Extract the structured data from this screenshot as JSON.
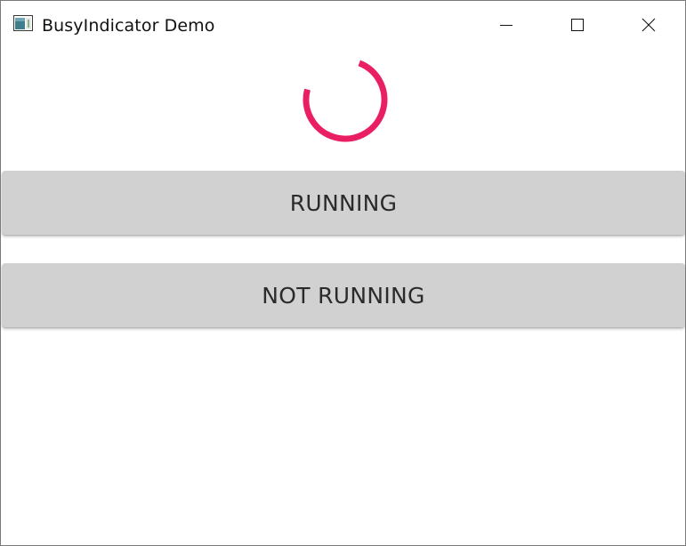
{
  "window": {
    "title": "BusyIndicator Demo",
    "app_icon": "app-window-icon",
    "controls": {
      "minimize_icon": "minimize-icon",
      "maximize_icon": "maximize-icon",
      "close_icon": "close-icon"
    }
  },
  "busy_indicator": {
    "icon": "spinner-icon",
    "color": "#e91e63"
  },
  "buttons": {
    "running_label": "RUNNING",
    "not_running_label": "NOT RUNNING",
    "background": "#d0d1d0"
  }
}
